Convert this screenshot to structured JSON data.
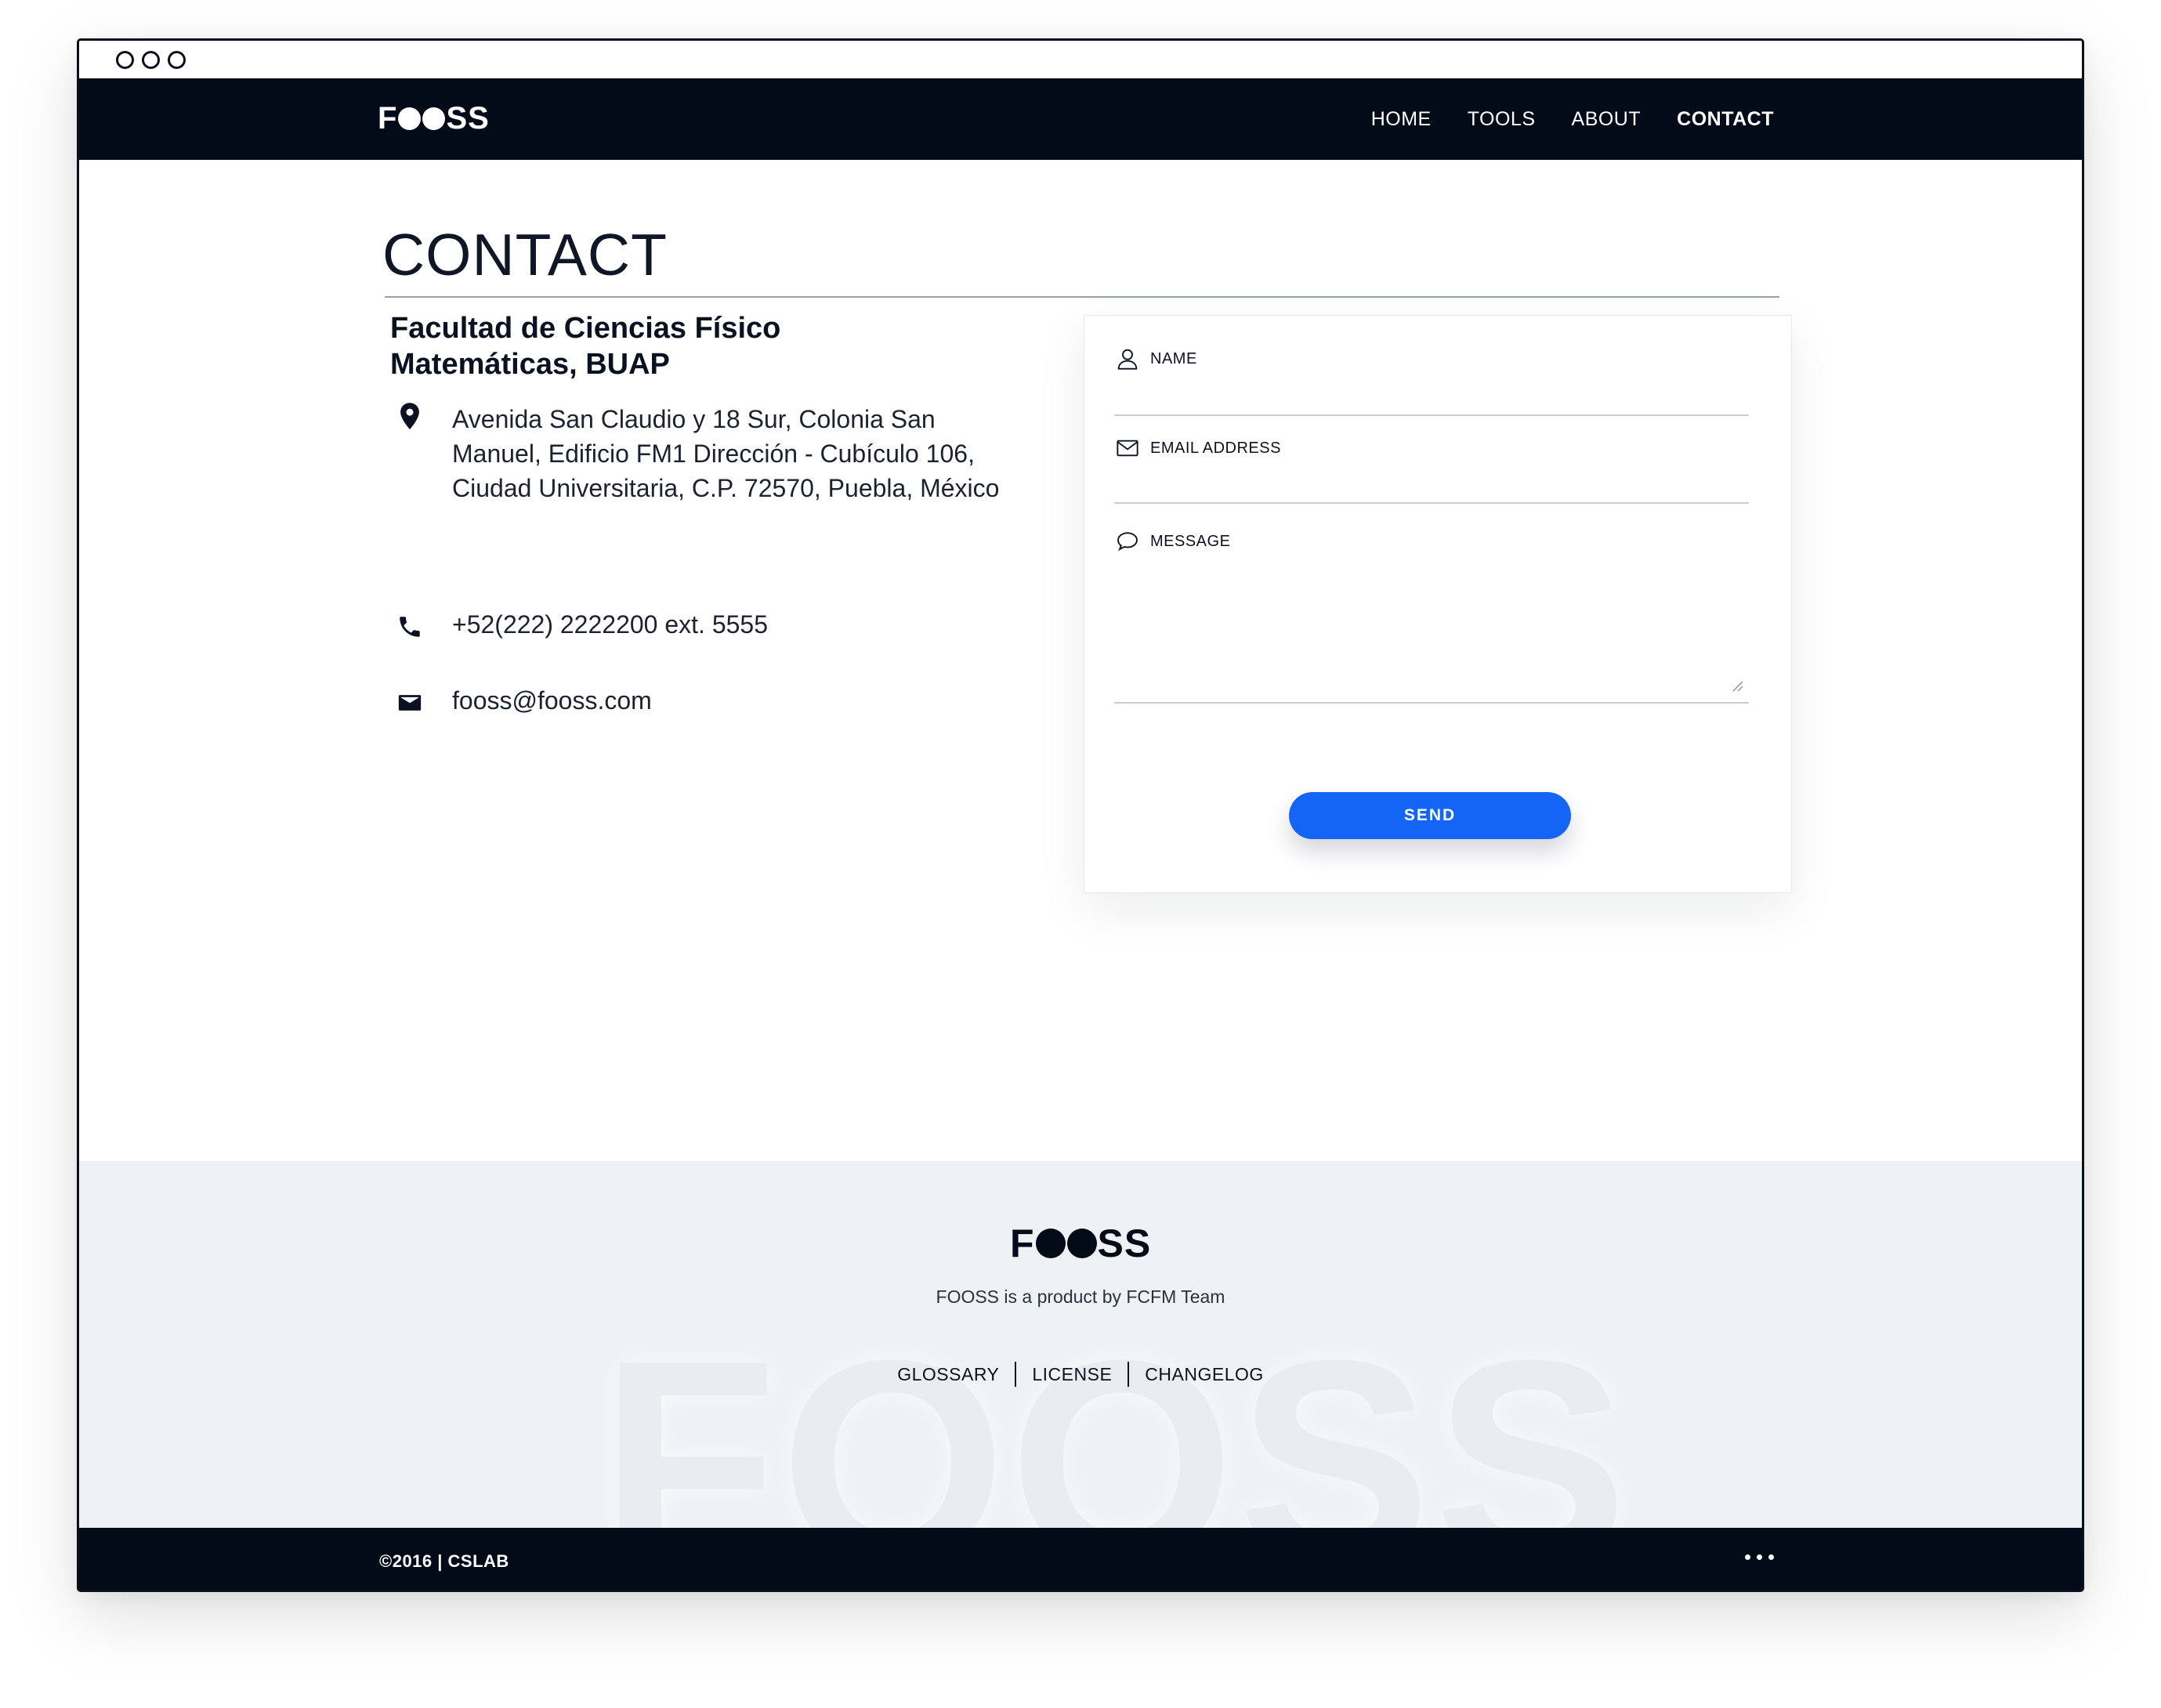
{
  "nav": {
    "logo": {
      "prefix": "F",
      "suffix": "SS"
    },
    "links": [
      "HOME",
      "TOOLS",
      "ABOUT",
      "CONTACT"
    ]
  },
  "page": {
    "title": "CONTACT"
  },
  "contact": {
    "org_name": "Facultad de Ciencias Físico Matemáticas, BUAP",
    "address": "Avenida San Claudio y 18 Sur, Colonia San Manuel, Edificio FM1 Dirección - Cubículo 106, Ciudad Universitaria, C.P. 72570, Puebla, México",
    "phone": "+52(222) 2222200 ext. 5555",
    "email": "fooss@fooss.com",
    "icons": [
      "map-pin-icon",
      "phone-icon",
      "envelope-icon"
    ]
  },
  "form": {
    "name_label": "NAME",
    "email_label": "EMAIL ADDRESS",
    "message_label": "MESSAGE",
    "send_label": "SEND",
    "icons": [
      "user-icon",
      "mail-outline-icon",
      "speech-bubble-icon"
    ]
  },
  "footer": {
    "logo": {
      "prefix": "F",
      "suffix": "SS"
    },
    "watermark": "FOOSS",
    "tagline": "FOOSS is a product by FCFM Team",
    "links": [
      "GLOSSARY",
      "LICENSE",
      "CHANGELOG"
    ],
    "copyright": "©2016 |  CSLAB"
  },
  "colors": {
    "navy": "#040b18",
    "accent_blue": "#1464f6",
    "footer_bg": "#eff2f5"
  }
}
